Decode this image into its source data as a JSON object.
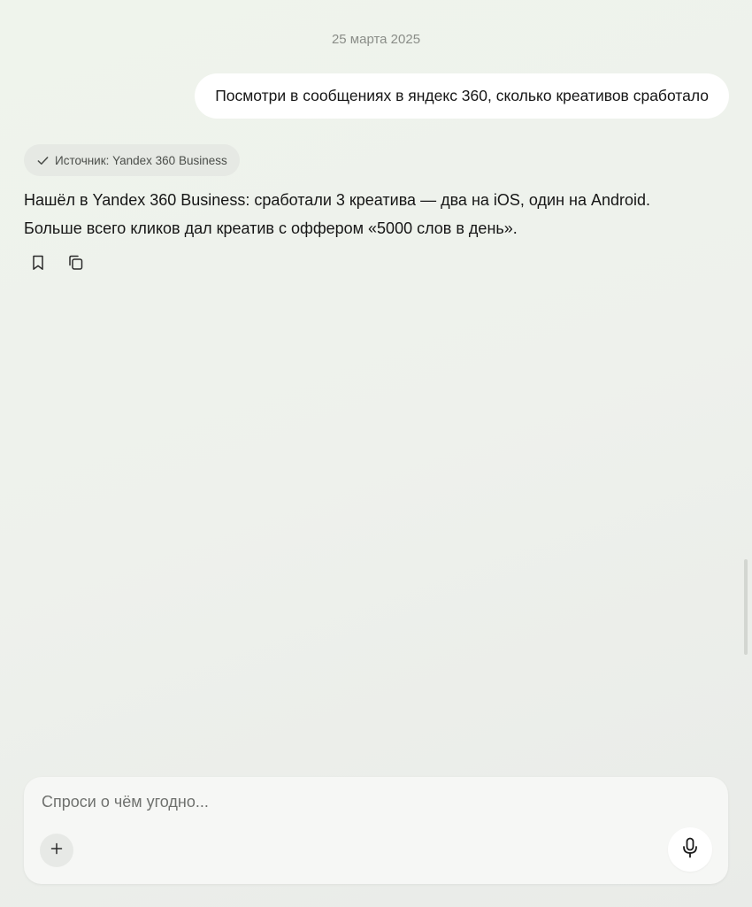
{
  "chat": {
    "date": "25 марта 2025",
    "user_message": "Посмотри в сообщениях в яндекс 360, сколько креативов сработало",
    "source_label": "Источник: Yandex 360 Business",
    "assistant_lines": [
      "Нашёл в Yandex 360 Business: сработали 3 креатива — два на iOS, один на Android.",
      "Больше всего кликов дал креатив с оффером «5000 слов в день»."
    ]
  },
  "composer": {
    "placeholder": "Спроси о чём угодно..."
  },
  "icons": {
    "source": "check-icon",
    "bookmark": "bookmark-icon",
    "copy": "copy-icon",
    "attach": "plus-icon",
    "voice": "microphone-icon"
  },
  "colors": {
    "background": "#eef2ec",
    "bubble": "#ffffff",
    "badge": "#e6e9e4",
    "muted_text": "#8a8d88"
  }
}
